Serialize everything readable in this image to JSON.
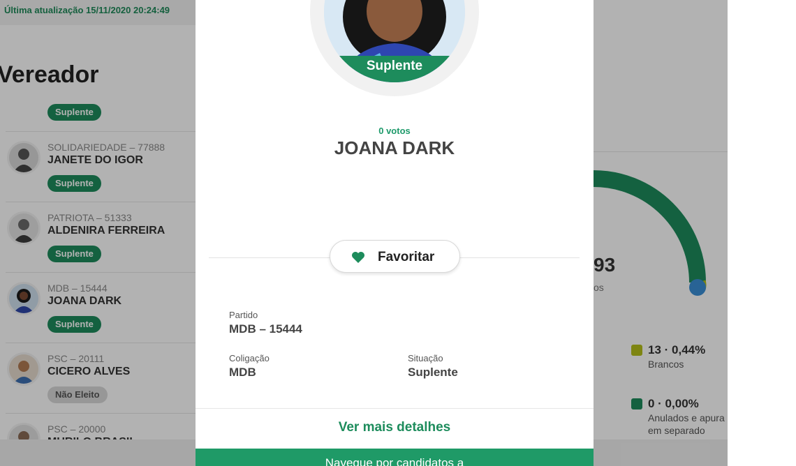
{
  "background": {
    "update_text": "Última atualização 15/11/2020 20:24:49",
    "page_heading": "Vereador",
    "first_badge": "Suplente",
    "candidates": [
      {
        "party": "SOLIDARIEDADE – 77888",
        "name": "JANETE DO IGOR",
        "status": "Suplente"
      },
      {
        "party": "PATRIOTA – 51333",
        "name": "ALDENIRA FERREIRA",
        "status": "Suplente"
      },
      {
        "party": "MDB – 15444",
        "name": "JOANA DARK",
        "status": "Suplente"
      },
      {
        "party": "PSC – 20111",
        "name": "CICERO ALVES",
        "status": "Não Eleito"
      },
      {
        "party": "PSC – 20000",
        "name": "MURILO BRASIL",
        "status": ""
      }
    ],
    "gauge": {
      "value_text": "93",
      "sub_text": "os"
    },
    "legend": [
      {
        "value": "13 · 0,44%",
        "label": "Brancos",
        "label2": "",
        "color": "#b5bf1a"
      },
      {
        "value": "0 · 0,00%",
        "label": "Anulados e apura",
        "label2": "em separado",
        "color": "#1d8c5c"
      }
    ]
  },
  "modal": {
    "photo_status": "Suplente",
    "votes": "0 votos",
    "name": "JOANA DARK",
    "favorite_label": "Favoritar",
    "party_label": "Partido",
    "party_value": "MDB – 15444",
    "coalition_label": "Coligação",
    "coalition_value": "MDB",
    "status_label": "Situação",
    "status_value": "Suplente",
    "details_link": "Ver mais detalhes",
    "nav_text": "Navegue por candidatos a"
  },
  "colors": {
    "accent_green": "#1d8c5c",
    "gauge_blue": "#3a8fd6"
  }
}
